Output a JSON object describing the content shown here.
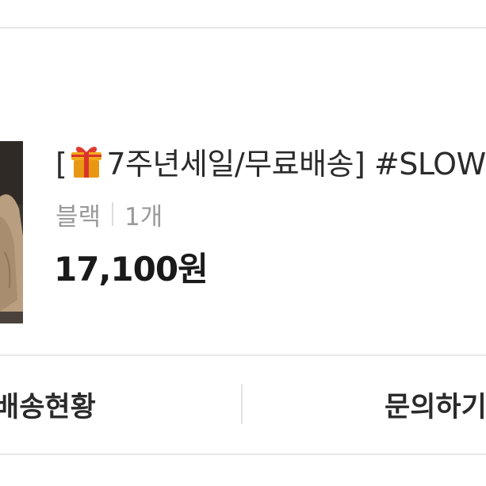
{
  "order_item": {
    "title_prefix": "[",
    "title_main": "7주년세일/무료배송] #SLOW",
    "gift_icon": "gift-box-icon",
    "option_color": "블랙",
    "option_quantity": "1개",
    "price": "17,100원"
  },
  "actions": {
    "delivery_status": "배송현황",
    "inquiry": "문의하기"
  },
  "colors": {
    "divider": "#e9e9e9",
    "text_primary": "#2b2b2b",
    "text_secondary": "#9a9a9a",
    "gift_red": "#d9342b",
    "gift_gold": "#f0a21a"
  }
}
